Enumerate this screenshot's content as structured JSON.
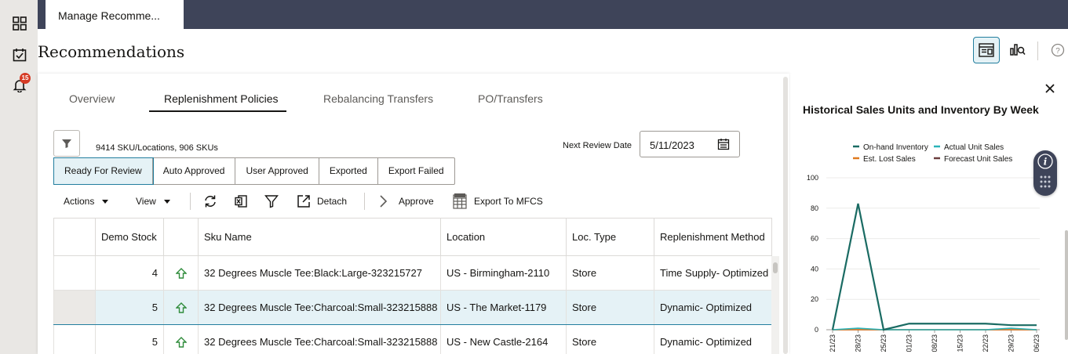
{
  "rail": {
    "items": [
      {
        "icon": "grid-icon"
      },
      {
        "icon": "task-check-icon"
      },
      {
        "icon": "bell-icon",
        "badge": "15"
      }
    ]
  },
  "top_tab": {
    "label": "Manage Recomme..."
  },
  "page": {
    "title": "Recommendations"
  },
  "tabs": [
    {
      "label": "Overview"
    },
    {
      "label": "Replenishment Policies",
      "active": true
    },
    {
      "label": "Rebalancing Transfers"
    },
    {
      "label": "PO/Transfers"
    }
  ],
  "summary": "9414 SKU/Locations, 906 SKUs",
  "next_review": {
    "label": "Next Review Date",
    "value": "5/11/2023"
  },
  "status_filters": [
    {
      "label": "Ready For Review",
      "selected": true
    },
    {
      "label": "Auto Approved"
    },
    {
      "label": "User Approved"
    },
    {
      "label": "Exported"
    },
    {
      "label": "Export Failed"
    }
  ],
  "toolbar": {
    "actions": "Actions",
    "view": "View",
    "detach": "Detach",
    "approve": "Approve",
    "export_mfcs": "Export To MFCS"
  },
  "table": {
    "columns": [
      "",
      "Demo Stock",
      "",
      "Sku Name",
      "Location",
      "Loc. Type",
      "Replenishment Method"
    ],
    "rows": [
      {
        "demo_stock": "4",
        "sku": "32 Degrees Muscle Tee:Black:Large-323215727",
        "location": "US - Birmingham-2110",
        "loc_type": "Store",
        "method": "Time Supply- Optimized",
        "selected": false
      },
      {
        "demo_stock": "5",
        "sku": "32 Degrees Muscle Tee:Charcoal:Small-323215888",
        "location": "US - The Market-1179",
        "loc_type": "Store",
        "method": "Dynamic- Optimized",
        "selected": true
      },
      {
        "demo_stock": "5",
        "sku": "32 Degrees Muscle Tee:Charcoal:Small-323215888",
        "location": "US - New Castle-2164",
        "loc_type": "Store",
        "method": "Dynamic- Optimized",
        "selected": false
      }
    ]
  },
  "colors": {
    "accent": "#227e9e",
    "topbar": "#3e4459",
    "on_hand": "#1a6b63",
    "actual_sales": "#2bb3b8",
    "lost_sales": "#e07a1f",
    "forecast": "#6b3d3d"
  },
  "chart_data": {
    "type": "line",
    "title": "Historical Sales Units and Inventory By Week",
    "legend_position": "top",
    "x": [
      "21/23",
      "28/23",
      "25/23",
      "01/23",
      "08/23",
      "15/23",
      "22/23",
      "29/23",
      "06/23"
    ],
    "ylim": [
      0,
      100
    ],
    "yticks": [
      0,
      20,
      40,
      60,
      80,
      100
    ],
    "grid": true,
    "series": [
      {
        "name": "On-hand Inventory",
        "values": [
          0,
          83,
          0,
          4,
          4,
          4,
          4,
          3,
          3
        ]
      },
      {
        "name": "Actual Unit Sales",
        "values": [
          0,
          1,
          0,
          0,
          0,
          0,
          0,
          1,
          0
        ]
      },
      {
        "name": "Est. Lost Sales",
        "values": [
          0,
          0,
          0,
          0,
          0,
          0,
          0,
          0,
          0
        ]
      },
      {
        "name": "Forecast Unit Sales",
        "values": [
          0,
          0,
          0,
          0,
          0,
          0,
          0,
          0,
          0
        ]
      }
    ]
  }
}
